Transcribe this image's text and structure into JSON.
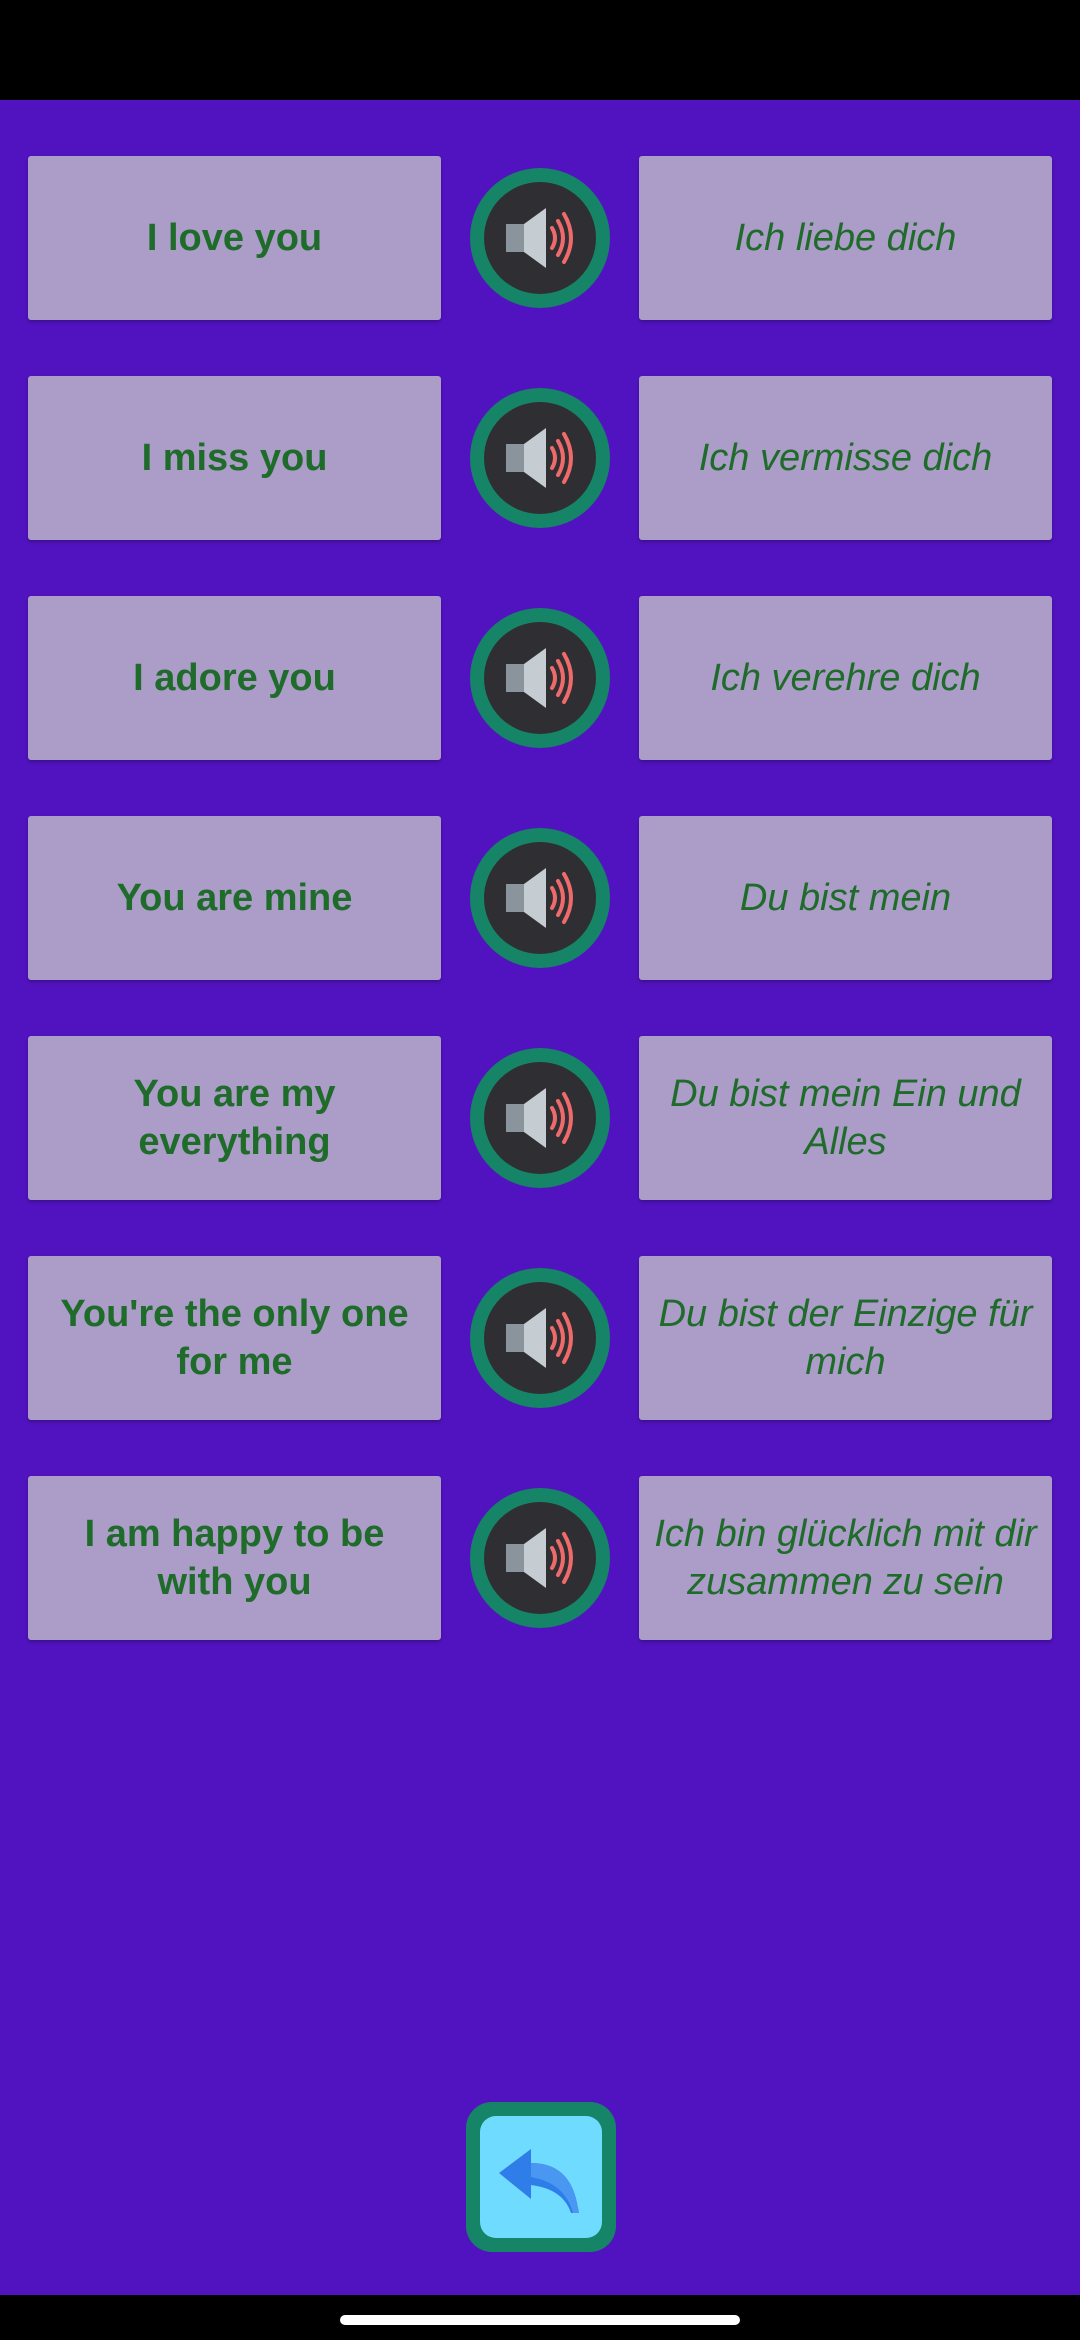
{
  "colors": {
    "background": "#5113bf",
    "card": "#ab9cc8",
    "text": "#1f6b2a",
    "speaker_ring": "#168466",
    "back_button_fill": "#6fdcff"
  },
  "phrases": [
    {
      "english": "I love you",
      "german": "Ich liebe dich",
      "icon": "speaker-icon"
    },
    {
      "english": "I miss you",
      "german": "Ich vermisse dich",
      "icon": "speaker-icon"
    },
    {
      "english": "I adore you",
      "german": "Ich verehre dich",
      "icon": "speaker-icon"
    },
    {
      "english": "You are mine",
      "german": "Du bist mein",
      "icon": "speaker-icon"
    },
    {
      "english": "You are my everything",
      "german": "Du bist mein Ein und Alles",
      "icon": "speaker-icon"
    },
    {
      "english": "You're the only one for me",
      "german": "Du bist der Einzige für mich",
      "icon": "speaker-icon"
    },
    {
      "english": "I am happy to be with you",
      "german": "Ich bin glücklich mit dir zusammen zu sein",
      "icon": "speaker-icon"
    }
  ],
  "back_button": {
    "icon": "back-arrow-icon"
  }
}
